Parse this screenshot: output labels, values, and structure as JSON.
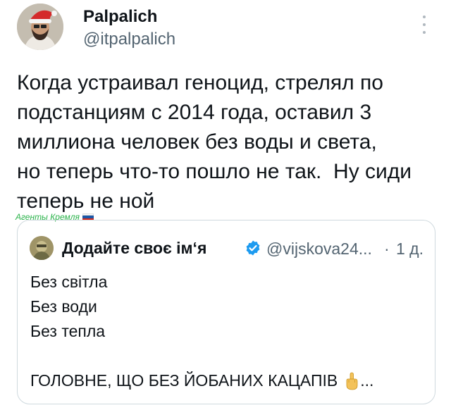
{
  "author": {
    "name": "Palpalich",
    "handle": "@itpalpalich",
    "avatar_icon": "santa-hat-avatar"
  },
  "tweet": {
    "text": "Когда устраивал геноцид, стрелял по\nподстанциям с 2014 года, оставил 3\nмиллиона человек без воды и света,\nно теперь что-то пошло не так.  Ну сиди\nтеперь не ной"
  },
  "watermark": {
    "text": "Агенты Кремля",
    "flag_colors": [
      "#ffffff",
      "#1c57a7",
      "#d52b1e"
    ]
  },
  "quote": {
    "name": "Додайте своє ім‘я",
    "handle": "@vijskova24...",
    "separator": "·",
    "time": "1 д.",
    "verified_color": "#1d9bf0",
    "lines": [
      "Без світла",
      "Без води",
      "Без тепла",
      ""
    ],
    "last_line": "ГОЛОВНЕ, ЩО БЕЗ ЙОБАНИХ КАЦАПІВ",
    "last_line_suffix": "...",
    "emoji_icon": "middle-finger-emoji-icon"
  }
}
